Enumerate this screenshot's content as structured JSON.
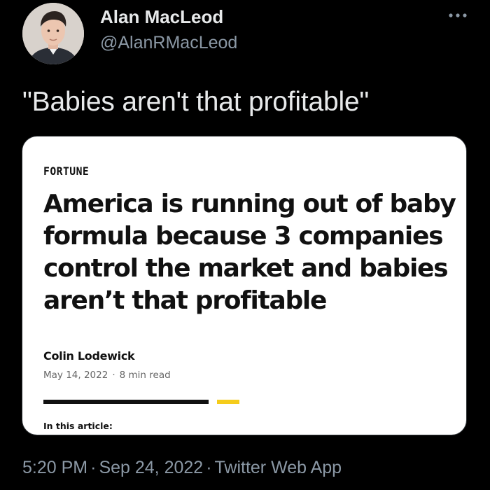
{
  "author": {
    "display_name": "Alan MacLeod",
    "handle": "@AlanRMacLeod",
    "avatar_icon": "profile-photo"
  },
  "more_icon": "more-options-icon",
  "tweet": {
    "text": "\"Babies aren't that profitable\""
  },
  "article_card": {
    "publication": "FORTUNE",
    "headline": "America is running out of baby formula because 3 companies control the market and babies aren’t that profitable",
    "byline": "Colin Lodewick",
    "date": "May 14, 2022",
    "separator": "·",
    "read_time": "8 min read",
    "in_this_article": "In this article:",
    "accent_color": "#f5cc1b"
  },
  "footer": {
    "time": "5:20 PM",
    "separator": "·",
    "date": "Sep 24, 2022",
    "source": "Twitter Web App"
  },
  "colors": {
    "background": "#000000",
    "primary_text": "#e7e9ea",
    "secondary_text": "#8b98a5",
    "card_background": "#ffffff"
  }
}
